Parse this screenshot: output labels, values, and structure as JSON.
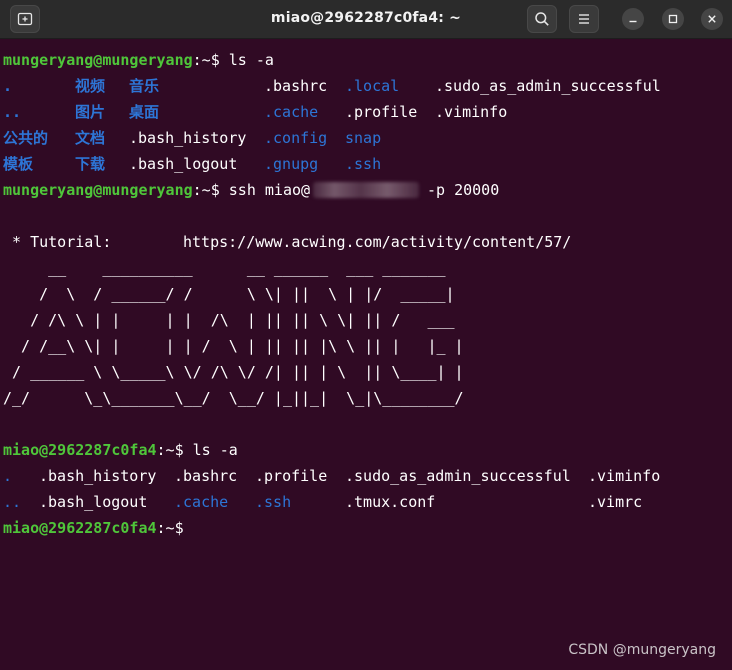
{
  "window": {
    "title": "miao@2962287c0fa4: ~"
  },
  "toolbar": {
    "new_tab_icon": "new-tab-icon",
    "search_icon": "search-icon",
    "menu_icon": "hamburger-menu-icon",
    "minimize_icon": "minimize-icon",
    "maximize_icon": "maximize-icon",
    "close_icon": "close-icon"
  },
  "colors": {
    "background": "#300a24",
    "prompt_user": "#4fc63a",
    "directory": "#2d75d6",
    "text": "#ffffff"
  },
  "terminal": {
    "prompt1_user": "mungeryang@mungeryang",
    "prompt_sep": ":~$",
    "cmd_ls": " ls -a",
    "ls1": [
      [
        ".",
        "视频",
        "音乐",
        ".bashrc",
        ".local",
        ".sudo_as_admin_successful"
      ],
      [
        "..",
        "图片",
        "桌面",
        ".cache",
        ".profile",
        ".viminfo"
      ],
      [
        "公共的",
        "文档",
        ".bash_history",
        ".config",
        "snap"
      ],
      [
        "模板",
        "下载",
        ".bash_logout",
        ".gnupg",
        ".ssh"
      ]
    ],
    "cmd_ssh_a": " ssh miao@",
    "cmd_ssh_b": "-p 20000",
    "tutorial_label": " * Tutorial:",
    "tutorial_url": "https://www.acwing.com/activity/content/57/",
    "art": [
      "     __    __________      __ ______  ___ _______",
      "    /  \\  / ______/ /      \\ \\| ||  \\ | |/  _____|",
      "   / /\\ \\ | |     | |  /\\  | || || \\ \\| || /   ___",
      "  / /__\\ \\| |     | | /  \\ | || || |\\ \\ || |   |_ |",
      " / ______ \\ \\_____\\ \\/ /\\ \\/ /| || | \\  || \\____| |",
      "/_/      \\_\\_______\\__/  \\__/ |_||_|  \\_|\\________/"
    ],
    "prompt2_user": "miao@2962287c0fa4",
    "ls2": [
      [
        ".",
        ".bash_history",
        ".bashrc",
        ".profile",
        ".sudo_as_admin_successful",
        ".viminfo"
      ],
      [
        "..",
        ".bash_logout",
        ".cache",
        ".ssh",
        ".tmux.conf",
        ".vimrc"
      ]
    ]
  },
  "watermark": "CSDN @mungeryang"
}
